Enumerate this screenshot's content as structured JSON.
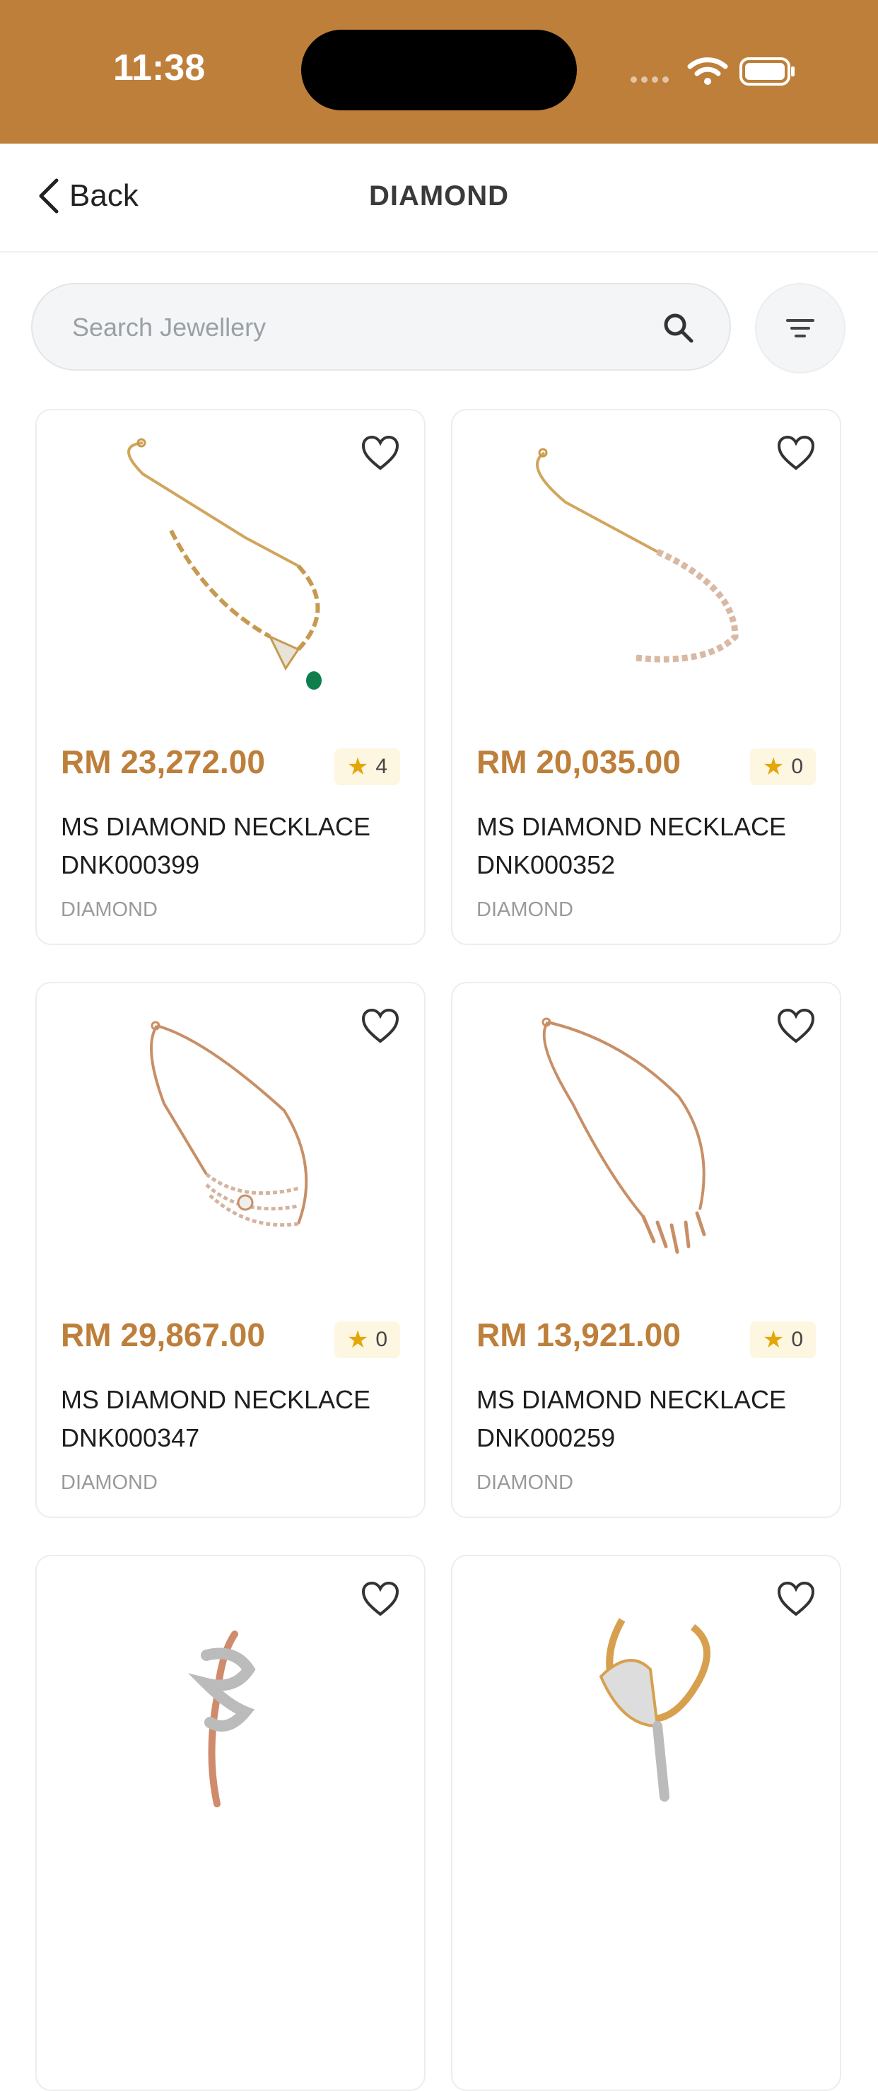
{
  "status_bar": {
    "time": "11:38"
  },
  "nav": {
    "back_label": "Back",
    "title": "DIAMOND"
  },
  "search": {
    "placeholder": "Search Jewellery",
    "value": ""
  },
  "colors": {
    "accent": "#BD7F3A",
    "star": "#E3A70B",
    "rating_bg": "#FDF6E0"
  },
  "products": [
    {
      "price": "RM 23,272.00",
      "rating": "4",
      "name": "MS DIAMOND NECKLACE DNK000399",
      "category": "DIAMOND",
      "image": "leaf-necklace-emerald"
    },
    {
      "price": "RM 20,035.00",
      "rating": "0",
      "name": "MS DIAMOND NECKLACE DNK000352",
      "category": "DIAMOND",
      "image": "tennis-necklace"
    },
    {
      "price": "RM 29,867.00",
      "rating": "0",
      "name": "MS DIAMOND NECKLACE DNK000347",
      "category": "DIAMOND",
      "image": "layered-necklace"
    },
    {
      "price": "RM 13,921.00",
      "rating": "0",
      "name": "MS DIAMOND NECKLACE DNK000259",
      "category": "DIAMOND",
      "image": "drop-necklace"
    },
    {
      "image": "rose-gold-ring"
    },
    {
      "image": "fan-ring"
    }
  ]
}
